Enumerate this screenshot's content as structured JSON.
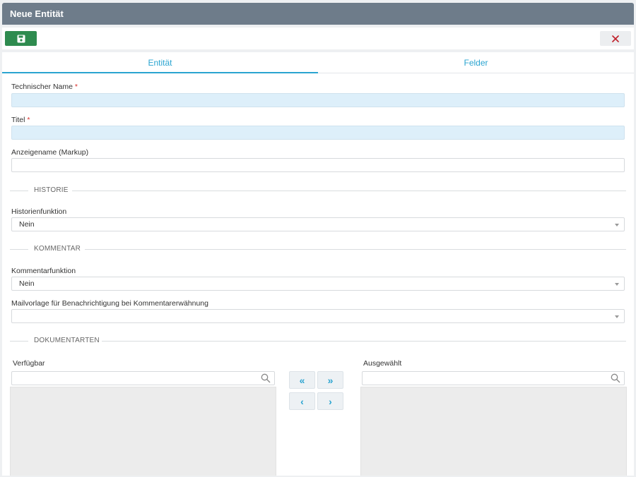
{
  "window": {
    "title": "Neue Entität"
  },
  "toolbar": {
    "save_icon": "floppy-disk-icon",
    "close_icon": "close-x-icon"
  },
  "tabs": [
    {
      "label": "Entität",
      "active": true
    },
    {
      "label": "Felder",
      "active": false
    }
  ],
  "form": {
    "technical_name": {
      "label": "Technischer Name",
      "required": "*",
      "value": ""
    },
    "title": {
      "label": "Titel",
      "required": "*",
      "value": ""
    },
    "display_name": {
      "label": "Anzeigename (Markup)",
      "value": ""
    },
    "history_section": "HISTORIE",
    "history_function": {
      "label": "Historienfunktion",
      "value": "Nein"
    },
    "comment_section": "KOMMENTAR",
    "comment_function": {
      "label": "Kommentarfunktion",
      "value": "Nein"
    },
    "mail_template": {
      "label": "Mailvorlage für Benachrichtigung bei Kommentarerwähnung",
      "value": ""
    },
    "doc_section": "DOKUMENTARTEN"
  },
  "doc_types": {
    "available_label": "Verfügbar",
    "available_search": "",
    "selected_label": "Ausgewählt",
    "selected_search": "",
    "buttons": {
      "add_all": "«",
      "remove_all": "»",
      "add_one": "‹",
      "remove_one": "›"
    }
  },
  "colors": {
    "titlebar": "#6e7c8a",
    "save": "#2e8b4f",
    "close_x": "#c0202a",
    "accent": "#2aa4d0",
    "required_field": "#ddeffa"
  }
}
